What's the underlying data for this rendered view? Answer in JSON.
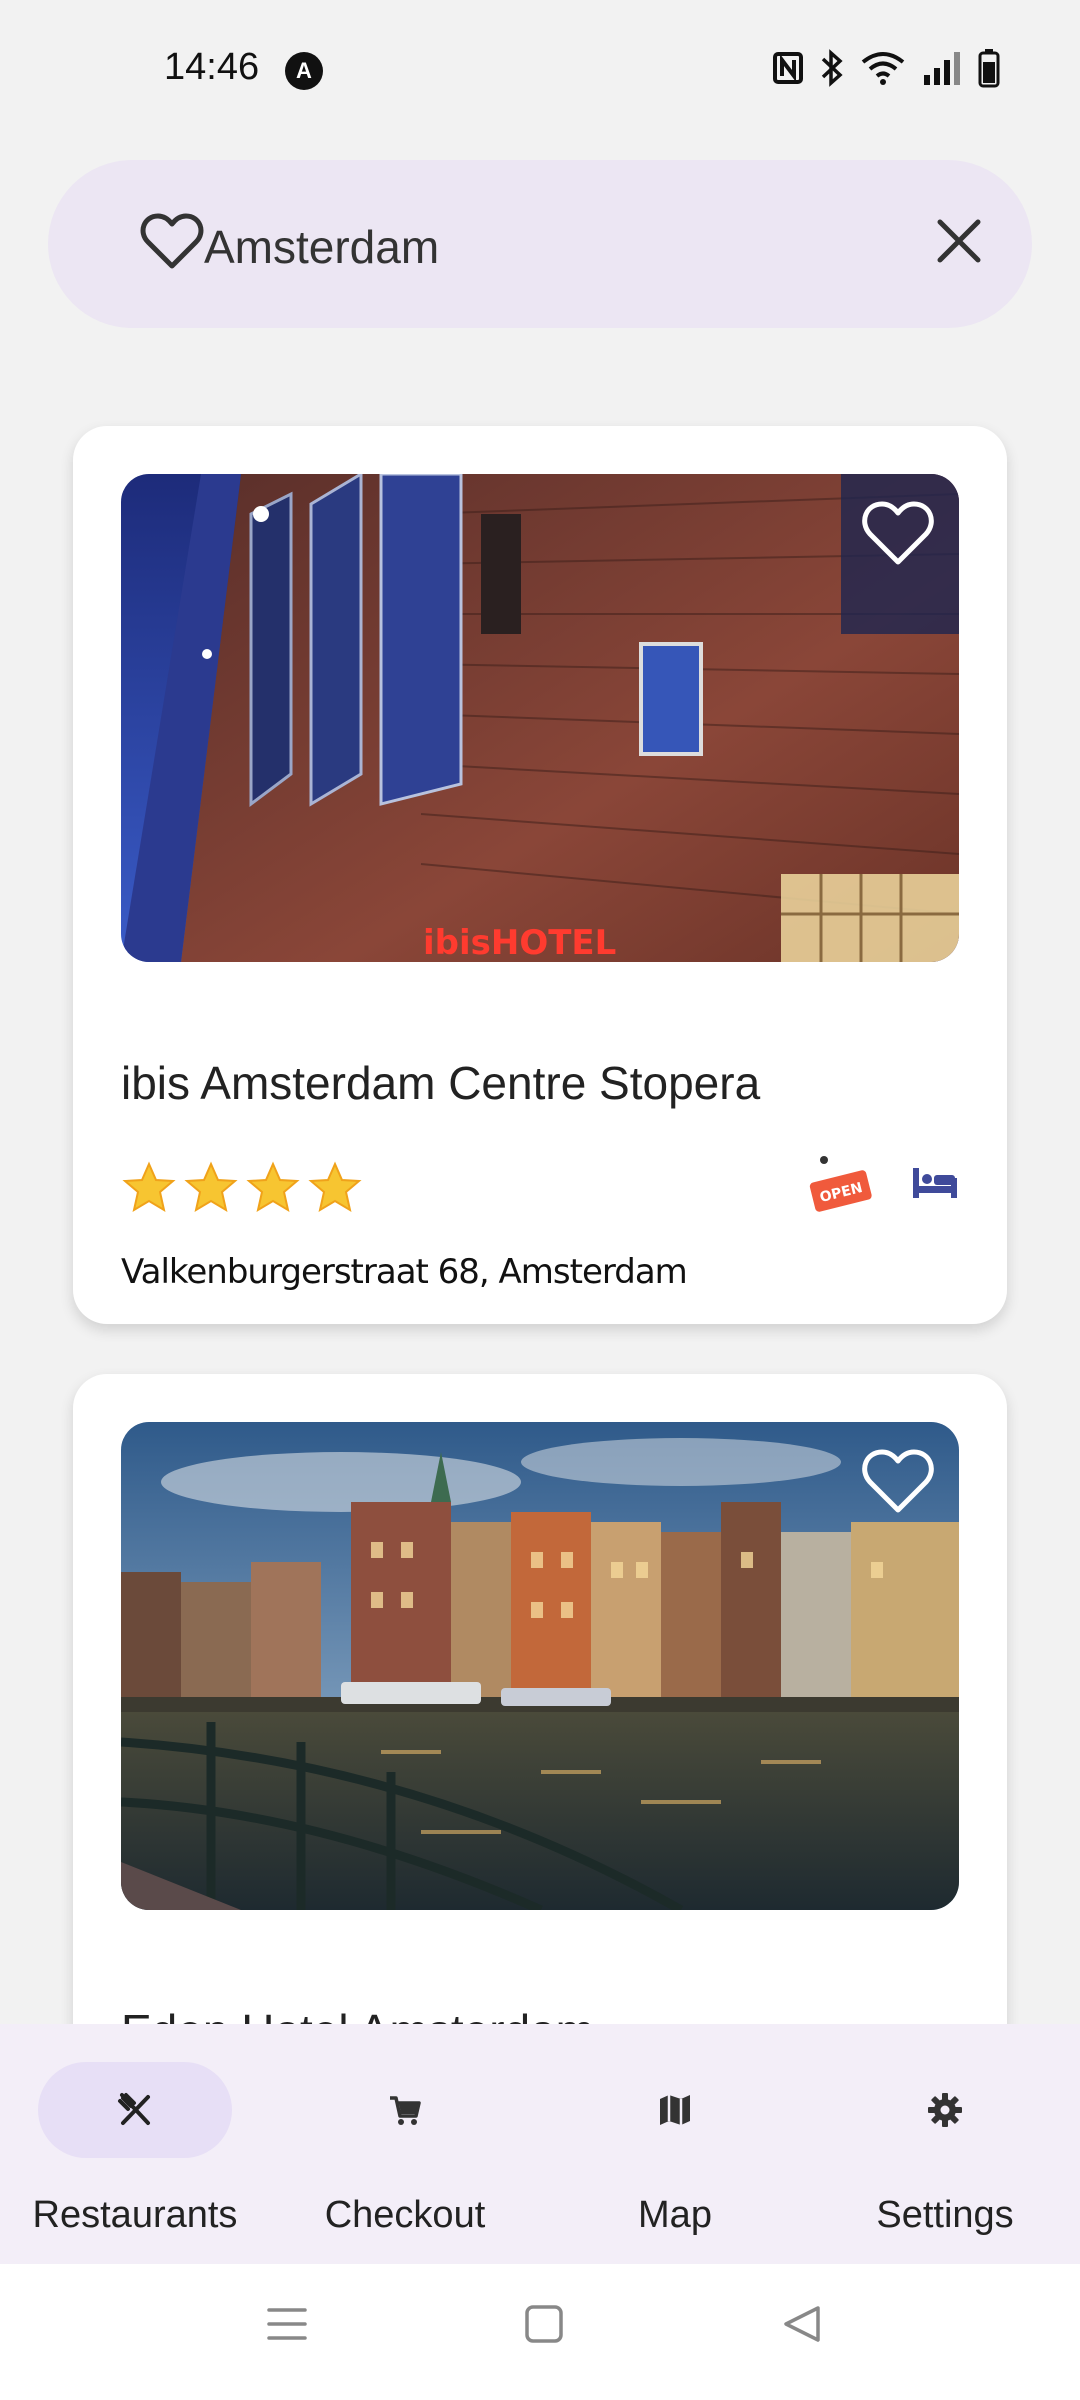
{
  "status_bar": {
    "time": "14:46",
    "badge": "A"
  },
  "search": {
    "value": "Amsterdam",
    "leading_icon": "heart-outline-icon",
    "trailing_icon": "close-icon"
  },
  "hotels": [
    {
      "name": "ibis Amsterdam Centre Stopera",
      "rating": 4,
      "address": "Valkenburgerstraat 68, Amsterdam",
      "status_badge": "OPEN",
      "image_sign": "ibisHOTEL"
    },
    {
      "name": "Eden Hotel Amsterdam"
    }
  ],
  "bottom_nav": {
    "items": [
      {
        "label": "Restaurants",
        "icon": "utensils-icon",
        "active": true
      },
      {
        "label": "Checkout",
        "icon": "cart-icon",
        "active": false
      },
      {
        "label": "Map",
        "icon": "map-icon",
        "active": false
      },
      {
        "label": "Settings",
        "icon": "gear-icon",
        "active": false
      }
    ]
  },
  "colors": {
    "background": "#f2f2f2",
    "search_bg": "#ece6f3",
    "nav_bg": "#f3eef8",
    "nav_active_pill": "#e7dff6",
    "open_badge": "#f05a3c",
    "bed_icon": "#3f4a9a"
  }
}
